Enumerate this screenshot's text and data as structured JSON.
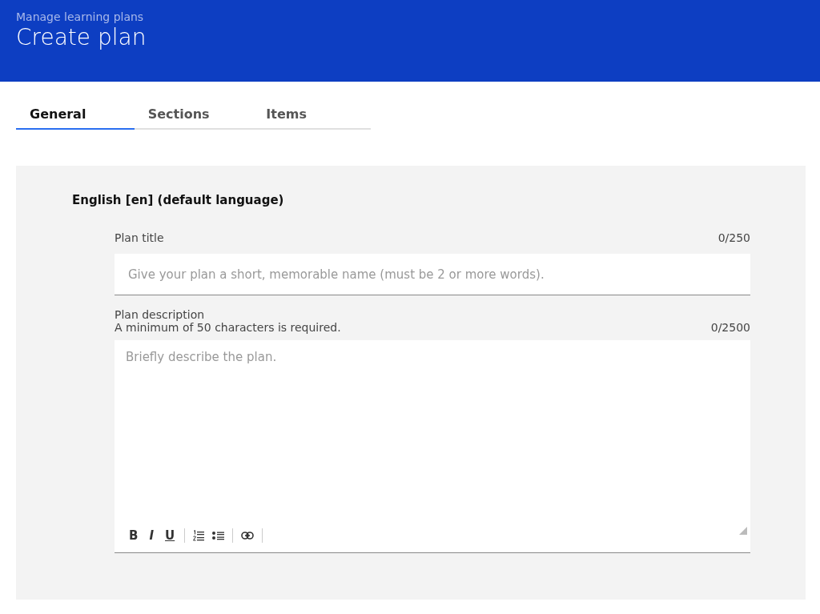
{
  "header": {
    "breadcrumb": "Manage learning plans",
    "title": "Create plan"
  },
  "tabs": [
    {
      "label": "General",
      "selected": true
    },
    {
      "label": "Sections",
      "selected": false
    },
    {
      "label": "Items",
      "selected": false
    }
  ],
  "language_heading": "English [en] (default language)",
  "title_field": {
    "label": "Plan title",
    "counter": "0/250",
    "placeholder": "Give your plan a short, memorable name (must be 2 or more words)."
  },
  "description_field": {
    "label": "Plan description",
    "hint": "A minimum of 50 characters is required.",
    "counter": "0/2500",
    "placeholder": "Briefly describe the plan.",
    "toolbar": [
      {
        "kind": "bold",
        "label": "B"
      },
      {
        "kind": "italic",
        "label": "I"
      },
      {
        "kind": "underline",
        "label": "U"
      },
      {
        "kind": "separator"
      },
      {
        "kind": "numbered"
      },
      {
        "kind": "bulleted"
      },
      {
        "kind": "separator"
      },
      {
        "kind": "link"
      },
      {
        "kind": "separator"
      }
    ]
  }
}
